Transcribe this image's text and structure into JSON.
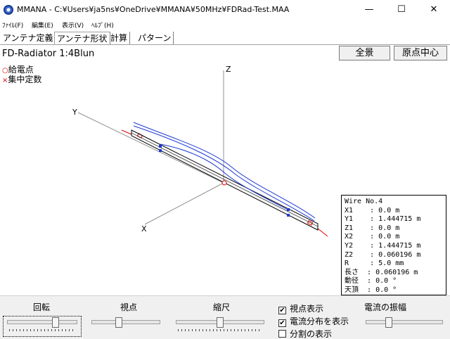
{
  "window": {
    "title": "MMANA - C:¥Users¥ja5ns¥OneDrive¥MMANA¥50MHz¥FDRad-Test.MAA",
    "minimize": "—",
    "maximize": "☐",
    "close": "✕"
  },
  "menu": [
    "ﾌｧｲﾙ(F)",
    "編集(E)",
    "表示(V)",
    "ﾍﾙﾌﾟ(H)"
  ],
  "tabs": [
    "アンテナ定義",
    "アンテナ形状",
    "計算",
    "パターン"
  ],
  "active_tab": "アンテナ形状",
  "model_name": "FD-Radiator 1:4Blun",
  "buttons": {
    "overview": "全景",
    "origin_center": "原点中心"
  },
  "legend": {
    "feed_mark": "○",
    "feed_label": "給電点",
    "load_mark": "×",
    "load_label": "集中定数"
  },
  "axes": {
    "z": "Z",
    "y": "Y",
    "x": "X"
  },
  "colors": {
    "wire": "#000000",
    "current": "#1f3ad6",
    "feed": "#e00000",
    "axis": "#909090"
  },
  "wire_info": [
    "Wire No.4",
    "X1    : 0.0 m",
    "Y1    : 1.444715 m",
    "Z1    : 0.0 m",
    "X2    : 0.0 m",
    "Y2    : 1.444715 m",
    "Z2    : 0.060196 m",
    "R     : 5.0 mm",
    "長さ  : 0.060196 m",
    "動径  : 0.0 °",
    "天頂  : 0.0 °"
  ],
  "controls": {
    "rotation": "回転",
    "viewpoint": "視点",
    "scale": "縮尺",
    "current_amplitude": "電流の振幅",
    "show_viewpoint": {
      "label": "視点表示",
      "checked": true
    },
    "show_current": {
      "label": "電流分布を表示",
      "checked": true
    },
    "show_segments": {
      "label": "分割の表示",
      "checked": false
    }
  }
}
